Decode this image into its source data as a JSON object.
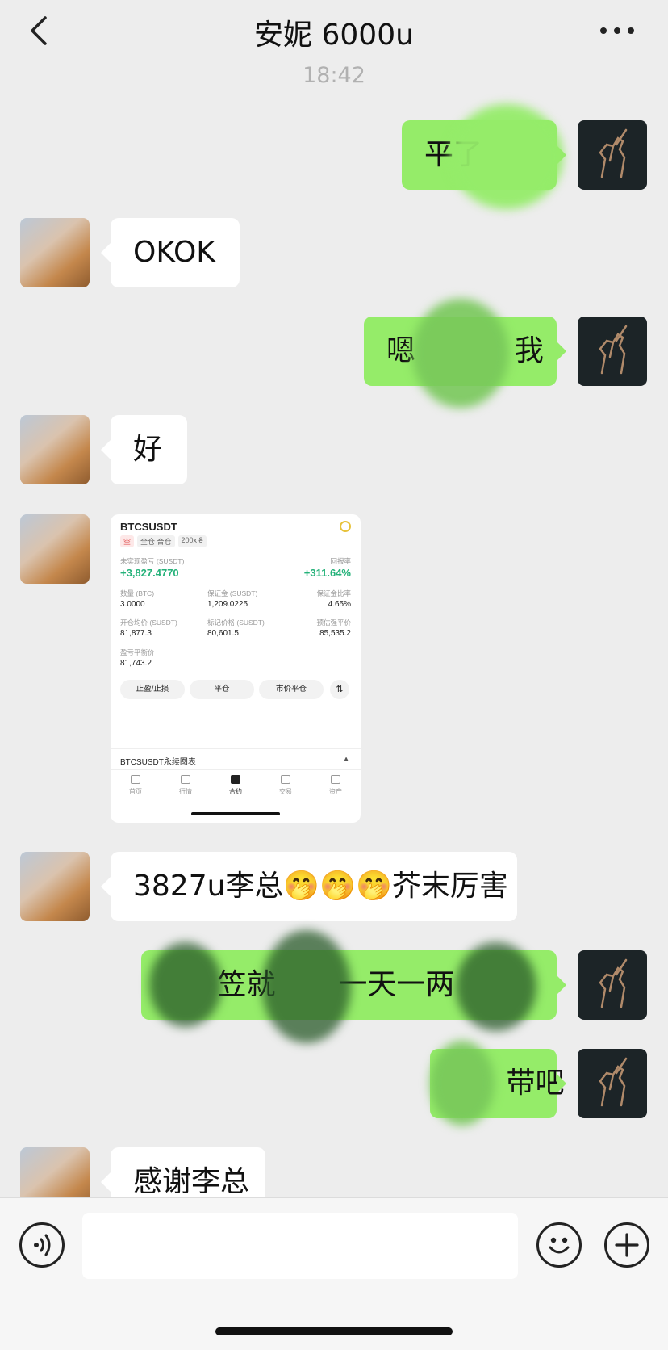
{
  "header": {
    "title": "安妮 6000u"
  },
  "timestamp": "18:42",
  "messages": [
    {
      "side": "right",
      "text": "平了"
    },
    {
      "side": "left",
      "text": "OKOK"
    },
    {
      "side": "right",
      "text_a": "嗯",
      "text_b": "我"
    },
    {
      "side": "left",
      "text": "好"
    },
    {
      "side": "left",
      "type": "image"
    },
    {
      "side": "left",
      "text": "3827u李总🤭🤭🤭芥末厉害"
    },
    {
      "side": "right",
      "text_a": "笠就",
      "text_b": "一天一两"
    },
    {
      "side": "right",
      "text": "带吧"
    },
    {
      "side": "left",
      "text": "感谢李总"
    }
  ],
  "screenshot": {
    "symbol": "BTCSUSDT",
    "tags": [
      "空",
      "全仓 合仓",
      "200x ₴"
    ],
    "unrealized_label": "未实现盈亏 (SUSDT)",
    "unrealized_value": "+3,827.4770",
    "roe_label": "回报率",
    "roe_value": "+311.64%",
    "qty_label": "数量 (BTC)",
    "qty_value": "3.0000",
    "margin_label": "保证金 (SUSDT)",
    "margin_value": "1,209.0225",
    "margin_ratio_label": "保证金比率",
    "margin_ratio_value": "4.65%",
    "entry_label": "开仓均价 (SUSDT)",
    "entry_value": "81,877.3",
    "mark_label": "标记价格 (SUSDT)",
    "mark_value": "80,601.5",
    "liq_label": "预估强平价",
    "liq_value": "85,535.2",
    "breakeven_label": "盈亏平衡价",
    "breakeven_value": "81,743.2",
    "buttons": [
      "止盈/止损",
      "平仓",
      "市价平仓"
    ],
    "chart_label": "BTCSUSDT永续图表",
    "nav": [
      "首页",
      "行情",
      "合约",
      "交易",
      "资产"
    ]
  },
  "input": {
    "value": ""
  },
  "colors": {
    "bg": "#ededed",
    "bubble_right": "#95ec69",
    "bubble_left": "#ffffff",
    "profit": "#25b27a"
  }
}
